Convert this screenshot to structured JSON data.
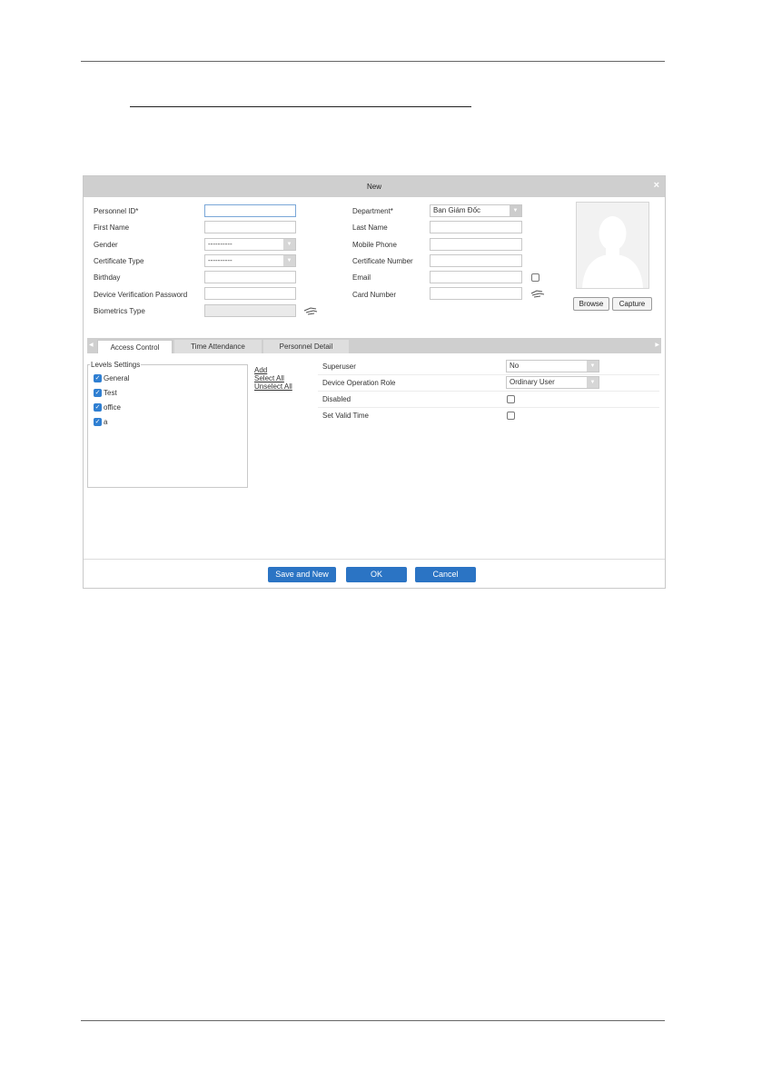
{
  "dialog": {
    "title": "New",
    "close_glyph": "×"
  },
  "form": {
    "personnel_id_label": "Personnel ID*",
    "personnel_id_value": "",
    "first_name_label": "First Name",
    "gender_label": "Gender",
    "gender_value": "----------",
    "certificate_type_label": "Certificate Type",
    "certificate_type_value": "----------",
    "birthday_label": "Birthday",
    "device_password_label": "Device Verification Password",
    "biometrics_label": "Biometrics Type",
    "department_label": "Department*",
    "department_value": "Ban Giám Đốc",
    "last_name_label": "Last Name",
    "mobile_label": "Mobile Phone",
    "certificate_number_label": "Certificate Number",
    "email_label": "Email",
    "card_number_label": "Card Number"
  },
  "photo": {
    "browse_label": "Browse",
    "capture_label": "Capture"
  },
  "tabs": [
    {
      "label": "Access Control",
      "active": true
    },
    {
      "label": "Time Attendance",
      "active": false
    },
    {
      "label": "Personnel Detail",
      "active": false
    }
  ],
  "levels": {
    "legend": "Levels Settings",
    "items": [
      {
        "label": "General",
        "checked": true
      },
      {
        "label": "Test",
        "checked": true
      },
      {
        "label": "office",
        "checked": true
      },
      {
        "label": "a",
        "checked": true
      }
    ],
    "add_label": "Add",
    "select_all_label": "Select All",
    "unselect_all_label": "Unselect All"
  },
  "access": {
    "superuser_label": "Superuser",
    "superuser_value": "No",
    "role_label": "Device Operation Role",
    "role_value": "Ordinary User",
    "disabled_label": "Disabled",
    "valid_time_label": "Set Valid Time"
  },
  "footer": {
    "save_new_label": "Save and New",
    "ok_label": "OK",
    "cancel_label": "Cancel"
  },
  "colors": {
    "primary_button": "#2b74c4",
    "titlebar": "#cfcfcf",
    "checkbox": "#2f7fd2"
  }
}
